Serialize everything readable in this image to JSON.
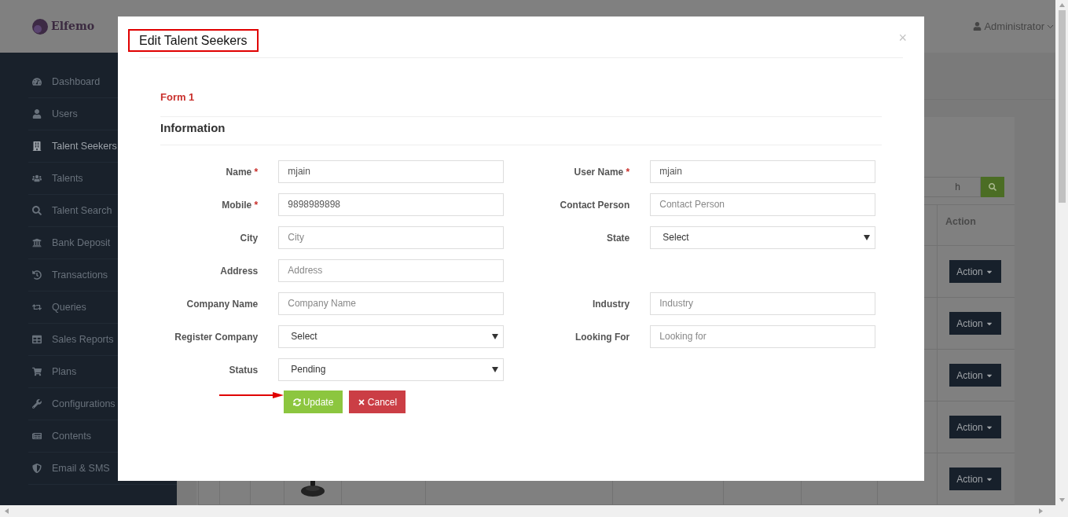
{
  "header": {
    "logo": "Elfemo",
    "user": "Administrator"
  },
  "sidebar": {
    "items": [
      {
        "label": "Dashboard",
        "selected": false
      },
      {
        "label": "Users",
        "selected": false
      },
      {
        "label": "Talent Seekers",
        "selected": true
      },
      {
        "label": "Talents",
        "selected": false
      },
      {
        "label": "Talent Search",
        "selected": false
      },
      {
        "label": "Bank Deposit",
        "selected": false
      },
      {
        "label": "Transactions",
        "selected": false
      },
      {
        "label": "Queries",
        "selected": false
      },
      {
        "label": "Sales Reports",
        "selected": false
      },
      {
        "label": "Plans",
        "selected": false
      },
      {
        "label": "Configurations",
        "selected": false
      },
      {
        "label": "Contents",
        "selected": false
      },
      {
        "label": "Email & SMS",
        "selected": false
      }
    ]
  },
  "table": {
    "search_placeholder": "h",
    "action_column": "Action",
    "row_actions": [
      "Action",
      "Action",
      "Action",
      "Action",
      "Action"
    ]
  },
  "modal": {
    "title": "Edit Talent Seekers",
    "close": "×",
    "section": "Form 1",
    "subsection": "Information",
    "rows": [
      {
        "left": {
          "label": "Name",
          "marker": "*",
          "kind": "text",
          "value": "mjain"
        },
        "right": {
          "label": "User Name",
          "marker": "*",
          "kind": "text",
          "value": "mjain"
        }
      },
      {
        "left": {
          "label": "Mobile",
          "marker": "*",
          "kind": "text",
          "value": "9898989898"
        },
        "right": {
          "label": "Contact Person",
          "kind": "text",
          "placeholder": "Contact Person"
        }
      },
      {
        "left": {
          "label": "City",
          "kind": "text",
          "placeholder": "City"
        },
        "right": {
          "label": "State",
          "kind": "select",
          "value": "Select"
        }
      },
      {
        "left": {
          "label": "Address",
          "kind": "text",
          "placeholder": "Address"
        }
      },
      {
        "left": {
          "label": "Company Name",
          "kind": "text",
          "placeholder": "Company Name"
        },
        "right": {
          "label": "Industry",
          "kind": "text",
          "placeholder": "Industry"
        }
      },
      {
        "left": {
          "label": "Register Company",
          "kind": "select",
          "value": "Select"
        },
        "right": {
          "label": "Looking For",
          "kind": "text",
          "placeholder": "Looking for"
        }
      },
      {
        "left": {
          "label": "Status",
          "kind": "select",
          "value": "Pending"
        }
      }
    ],
    "buttons": [
      {
        "label": "Update",
        "kind": "update"
      },
      {
        "label": "Cancel",
        "kind": "cancel"
      }
    ]
  }
}
